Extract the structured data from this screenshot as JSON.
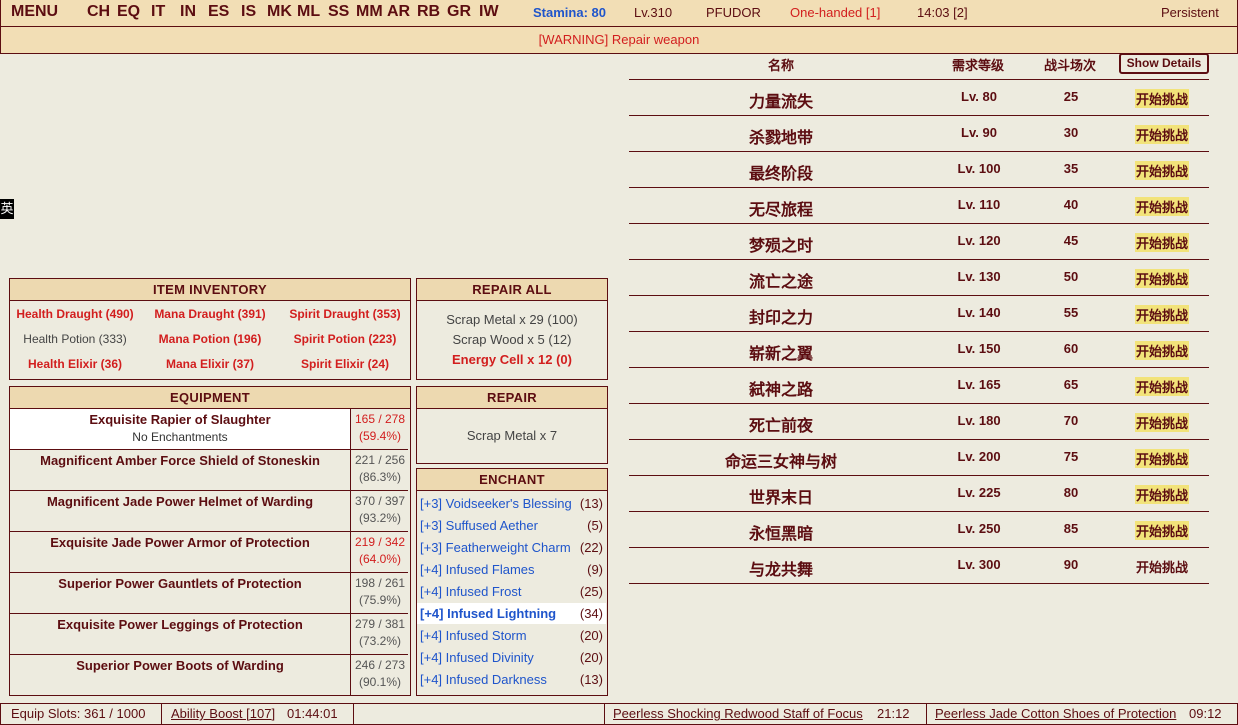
{
  "topbar": {
    "menu": "MENU",
    "nav": [
      "CH",
      "EQ",
      "IT",
      "IN",
      "ES",
      "IS",
      "MK",
      "ML",
      "SS",
      "MM",
      "AR",
      "RB",
      "GR",
      "IW"
    ],
    "stamina": "Stamina: 80",
    "level": "Lv.310",
    "name": "PFUDOR",
    "style": "One-handed [1]",
    "time": "14:03 [2]",
    "persistent": "Persistent"
  },
  "warning": "[WARNING] Repair weapon",
  "ime_tag": "英",
  "inventory": {
    "title": "ITEM INVENTORY",
    "rows": [
      [
        {
          "text": "Health Draught (490)",
          "warn": true
        },
        {
          "text": "Mana Draught (391)",
          "warn": true
        },
        {
          "text": "Spirit Draught (353)",
          "warn": true
        }
      ],
      [
        {
          "text": "Health Potion (333)",
          "warn": false
        },
        {
          "text": "Mana Potion (196)",
          "warn": true
        },
        {
          "text": "Spirit Potion (223)",
          "warn": true
        }
      ],
      [
        {
          "text": "Health Elixir (36)",
          "warn": true
        },
        {
          "text": "Mana Elixir (37)",
          "warn": true
        },
        {
          "text": "Spirit Elixir (24)",
          "warn": true
        }
      ]
    ]
  },
  "repair_all": {
    "title": "REPAIR ALL",
    "lines": [
      "Scrap Metal x 29 (100)",
      "Scrap Wood x 5 (12)",
      "Energy Cell x 12 (0)"
    ]
  },
  "repair": {
    "title": "REPAIR",
    "line": "Scrap Metal x 7"
  },
  "equipment": {
    "title": "EQUIPMENT",
    "items": [
      {
        "name": "Exquisite Rapier of Slaughter",
        "enchant": "No Enchantments",
        "cond": "165 / 278",
        "pct": "(59.4%)",
        "warn": true,
        "selected": true
      },
      {
        "name": "Magnificent Amber Force Shield of Stoneskin",
        "enchant": "",
        "cond": "221 / 256",
        "pct": "(86.3%)",
        "warn": false,
        "selected": false
      },
      {
        "name": "Magnificent Jade Power Helmet of Warding",
        "enchant": "",
        "cond": "370 / 397",
        "pct": "(93.2%)",
        "warn": false,
        "selected": false
      },
      {
        "name": "Exquisite Jade Power Armor of Protection",
        "enchant": "",
        "cond": "219 / 342",
        "pct": "(64.0%)",
        "warn": true,
        "selected": false
      },
      {
        "name": "Superior Power Gauntlets of Protection",
        "enchant": "",
        "cond": "198 / 261",
        "pct": "(75.9%)",
        "warn": false,
        "selected": false
      },
      {
        "name": "Exquisite Power Leggings of Protection",
        "enchant": "",
        "cond": "279 / 381",
        "pct": "(73.2%)",
        "warn": false,
        "selected": false
      },
      {
        "name": "Superior Power Boots of Warding",
        "enchant": "",
        "cond": "246 / 273",
        "pct": "(90.1%)",
        "warn": false,
        "selected": false
      }
    ]
  },
  "enchant": {
    "title": "ENCHANT",
    "items": [
      {
        "label": "[+3] Voidseeker's Blessing",
        "count": "(13)",
        "selected": false
      },
      {
        "label": "[+3] Suffused Aether",
        "count": "(5)",
        "selected": false
      },
      {
        "label": "[+3] Featherweight Charm",
        "count": "(22)",
        "selected": false
      },
      {
        "label": "[+4] Infused Flames",
        "count": "(9)",
        "selected": false
      },
      {
        "label": "[+4] Infused Frost",
        "count": "(25)",
        "selected": false
      },
      {
        "label": "[+4] Infused Lightning",
        "count": "(34)",
        "selected": true
      },
      {
        "label": "[+4] Infused Storm",
        "count": "(20)",
        "selected": false
      },
      {
        "label": "[+4] Infused Divinity",
        "count": "(20)",
        "selected": false
      },
      {
        "label": "[+4] Infused Darkness",
        "count": "(13)",
        "selected": false
      }
    ]
  },
  "tower": {
    "headers": {
      "name": "名称",
      "level": "需求等级",
      "battles": "战斗场次"
    },
    "show_details": "Show Details",
    "rows": [
      {
        "name": "力量流失",
        "level": "Lv. 80",
        "battles": "25",
        "action": "开始挑战",
        "highlight": true
      },
      {
        "name": "杀戮地带",
        "level": "Lv. 90",
        "battles": "30",
        "action": "开始挑战",
        "highlight": true
      },
      {
        "name": "最终阶段",
        "level": "Lv. 100",
        "battles": "35",
        "action": "开始挑战",
        "highlight": true
      },
      {
        "name": "无尽旅程",
        "level": "Lv. 110",
        "battles": "40",
        "action": "开始挑战",
        "highlight": true
      },
      {
        "name": "梦殒之时",
        "level": "Lv. 120",
        "battles": "45",
        "action": "开始挑战",
        "highlight": true
      },
      {
        "name": "流亡之途",
        "level": "Lv. 130",
        "battles": "50",
        "action": "开始挑战",
        "highlight": true
      },
      {
        "name": "封印之力",
        "level": "Lv. 140",
        "battles": "55",
        "action": "开始挑战",
        "highlight": true
      },
      {
        "name": "崭新之翼",
        "level": "Lv. 150",
        "battles": "60",
        "action": "开始挑战",
        "highlight": true
      },
      {
        "name": "弑神之路",
        "level": "Lv. 165",
        "battles": "65",
        "action": "开始挑战",
        "highlight": true
      },
      {
        "name": "死亡前夜",
        "level": "Lv. 180",
        "battles": "70",
        "action": "开始挑战",
        "highlight": true
      },
      {
        "name": "命运三女神与树",
        "level": "Lv. 200",
        "battles": "75",
        "action": "开始挑战",
        "highlight": true
      },
      {
        "name": "世界末日",
        "level": "Lv. 225",
        "battles": "80",
        "action": "开始挑战",
        "highlight": true
      },
      {
        "name": "永恒黑暗",
        "level": "Lv. 250",
        "battles": "85",
        "action": "开始挑战",
        "highlight": true
      },
      {
        "name": "与龙共舞",
        "level": "Lv. 300",
        "battles": "90",
        "action": "开始挑战",
        "highlight": false
      }
    ]
  },
  "footer": {
    "equip_slots": "Equip Slots: 361 / 1000",
    "ability_boost": "Ability Boost [107]",
    "ability_time": "01:44:01",
    "item1": "Peerless Shocking Redwood Staff of Focus",
    "item1_time": "21:12",
    "item2": "Peerless Jade Cotton Shoes of Protection",
    "item2_time": "09:12"
  },
  "colors": {
    "accent": "#5C0D11",
    "warn": "#D21E1E",
    "link": "#1F55CB",
    "bar": "#F2DEB5",
    "bg": "#EDEBDF",
    "btn": "#F2E37A"
  }
}
